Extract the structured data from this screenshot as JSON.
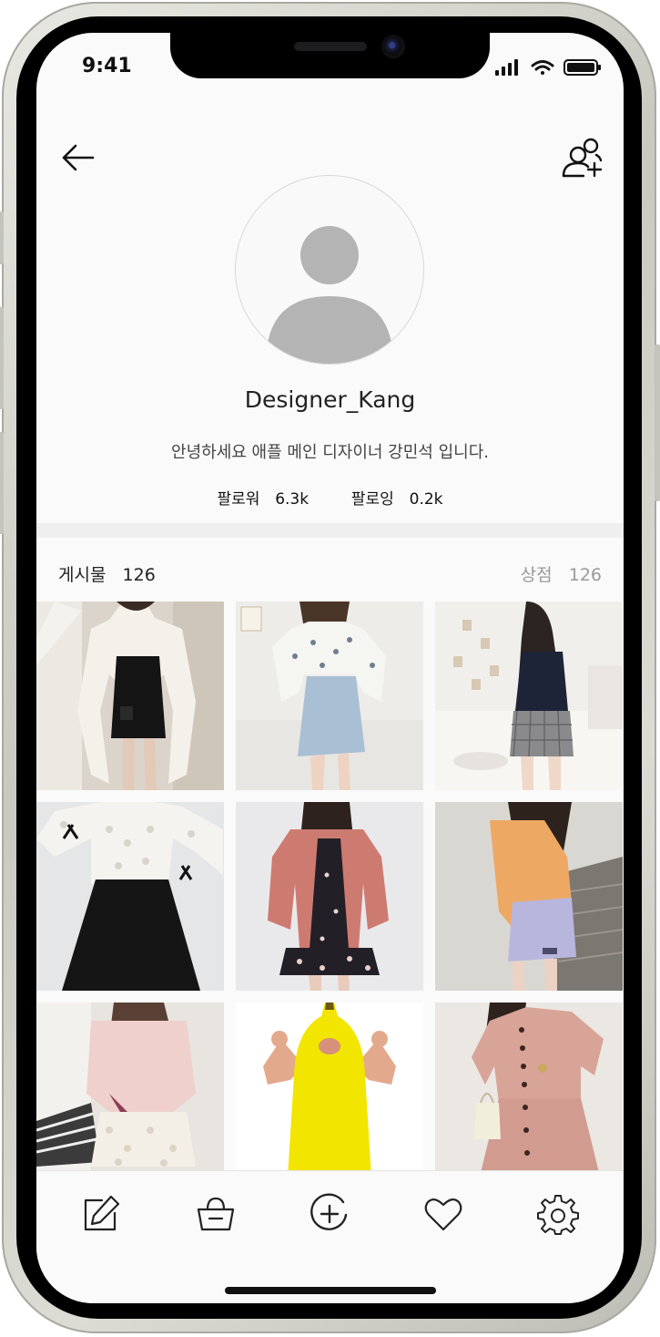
{
  "status_bar": {
    "time": "9:41"
  },
  "profile": {
    "username": "Designer_Kang",
    "bio": "안녕하세요 애플 메인 디자이너 강민석 입니다.",
    "followers_label": "팔로워",
    "followers_count": "6.3k",
    "following_label": "팔로잉",
    "following_count": "0.2k"
  },
  "tabs": {
    "posts_label": "게시물",
    "posts_count": "126",
    "shop_label": "상점",
    "shop_count": "126"
  },
  "posts": [
    {
      "alt": "white blouse black skirt"
    },
    {
      "alt": "floral blouse blue skirt"
    },
    {
      "alt": "navy top plaid skirt"
    },
    {
      "alt": "lace blouse black skirt"
    },
    {
      "alt": "pink cardigan floral dress"
    },
    {
      "alt": "yellow cardigan lavender skirt"
    },
    {
      "alt": "pink blouse lace skirt"
    },
    {
      "alt": "banana costume"
    },
    {
      "alt": "pink button dress"
    }
  ],
  "icons": {
    "back": "arrow-left-icon",
    "add_friend": "user-add-icon",
    "edit": "edit-icon",
    "shop": "basket-icon",
    "add": "plus-circle-icon",
    "like": "heart-icon",
    "settings": "gear-icon"
  }
}
